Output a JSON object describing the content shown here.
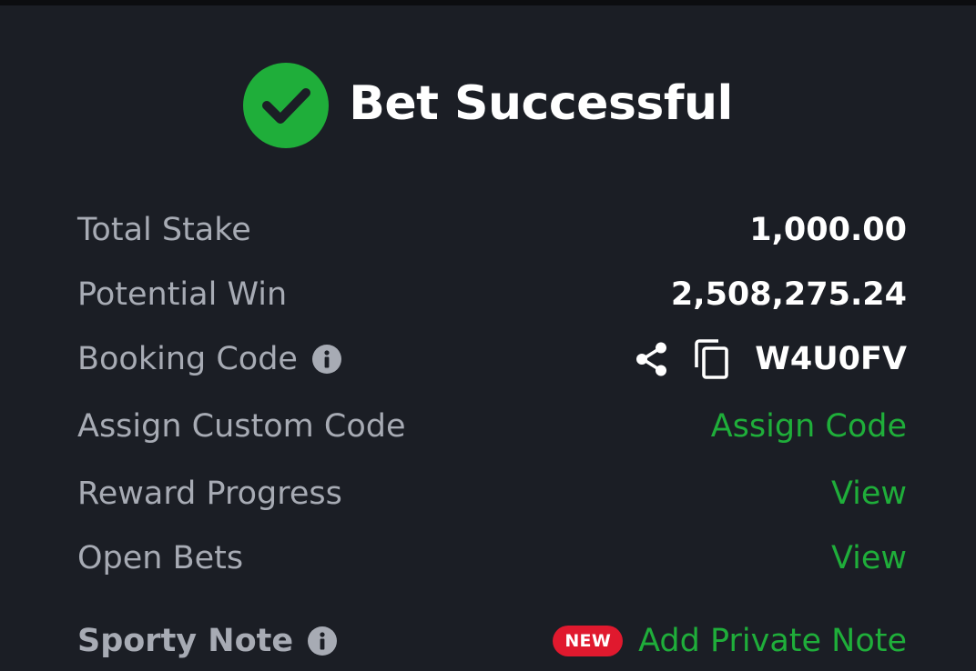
{
  "header": {
    "title": "Bet Successful"
  },
  "rows": {
    "total_stake": {
      "label": "Total Stake",
      "value": "1,000.00"
    },
    "potential_win": {
      "label": "Potential Win",
      "value": "2,508,275.24"
    },
    "booking_code": {
      "label": "Booking Code",
      "value": "W4U0FV"
    },
    "assign_custom_code": {
      "label": "Assign Custom Code",
      "action": "Assign Code"
    },
    "reward_progress": {
      "label": "Reward Progress",
      "action": "View"
    },
    "open_bets": {
      "label": "Open Bets",
      "action": "View"
    },
    "sporty_note": {
      "label": "Sporty Note",
      "badge": "NEW",
      "action": "Add Private Note"
    }
  },
  "colors": {
    "background": "#1b1e25",
    "accent_green": "#1fae3a",
    "label_gray": "#a7abb4",
    "badge_red": "#e0192e"
  },
  "icons": {
    "success": "check-circle-icon",
    "info": "info-icon",
    "share": "share-icon",
    "copy": "copy-icon"
  }
}
